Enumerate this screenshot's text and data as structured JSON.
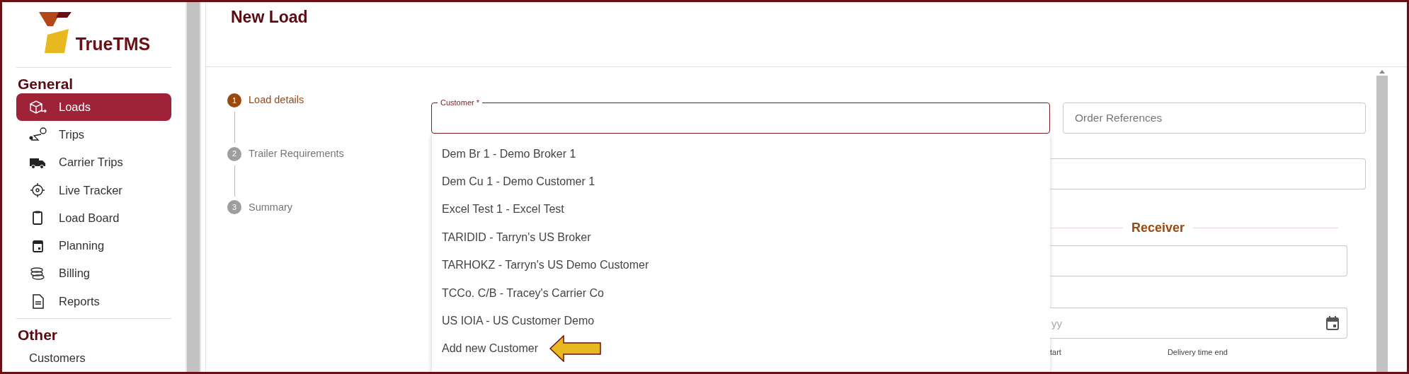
{
  "sidebar": {
    "logo_text": "TrueTMS",
    "sections": [
      {
        "title": "General",
        "items": [
          {
            "label": "Loads",
            "selected": true
          },
          {
            "label": "Trips",
            "selected": false
          },
          {
            "label": "Carrier Trips",
            "selected": false
          },
          {
            "label": "Live Tracker",
            "selected": false
          },
          {
            "label": "Load Board",
            "selected": false
          },
          {
            "label": "Planning",
            "selected": false
          },
          {
            "label": "Billing",
            "selected": false
          },
          {
            "label": "Reports",
            "selected": false
          }
        ]
      },
      {
        "title": "Other",
        "items": [
          {
            "label": "Customers",
            "selected": false
          }
        ]
      }
    ]
  },
  "page": {
    "title": "New Load"
  },
  "steps": [
    {
      "number": "1",
      "label": "Load details",
      "selected": true
    },
    {
      "number": "2",
      "label": "Trailer Requirements",
      "selected": false
    },
    {
      "number": "3",
      "label": "Summary",
      "selected": false
    }
  ],
  "form": {
    "customer_field": {
      "label": "Customer *"
    },
    "order_references": {
      "placeholder": "Order References"
    },
    "customer_options": [
      {
        "label": "Dem Br 1 - Demo Broker 1",
        "kind": "option"
      },
      {
        "label": "Dem Cu 1 - Demo Customer 1",
        "kind": "option"
      },
      {
        "label": "Excel Test 1 - Excel Test",
        "kind": "option"
      },
      {
        "label": "TARIDID - Tarryn's US Broker",
        "kind": "option"
      },
      {
        "label": "TARHOKZ - Tarryn's US Demo Customer",
        "kind": "option"
      },
      {
        "label": "TCCo. C/B - Tracey's Carrier Co",
        "kind": "option"
      },
      {
        "label": "US IOIA - US Customer Demo",
        "kind": "option"
      },
      {
        "label": "Add new Customer",
        "kind": "action"
      }
    ],
    "receiver_heading": "Receiver",
    "date_field": {
      "placeholder": "yy"
    },
    "time_labels": [
      "tart",
      "Delivery time end"
    ]
  }
}
